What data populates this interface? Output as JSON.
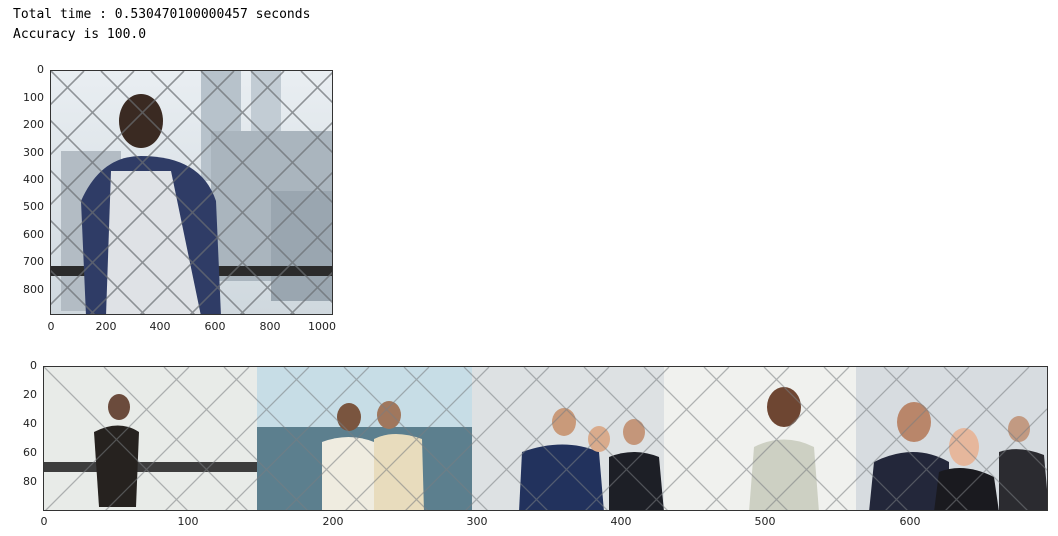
{
  "output": {
    "line1": "Total time : 0.530470100000457 seconds",
    "line2": "Accuracy is 100.0"
  },
  "plot1": {
    "yticks": [
      "0",
      "100",
      "200",
      "300",
      "400",
      "500",
      "600",
      "700",
      "800"
    ],
    "xticks": [
      "0",
      "200",
      "400",
      "600",
      "800",
      "1000"
    ]
  },
  "plot2": {
    "yticks": [
      "0",
      "20",
      "40",
      "60",
      "80"
    ],
    "xticks": [
      "0",
      "100",
      "200",
      "300",
      "400",
      "500",
      "600"
    ]
  }
}
